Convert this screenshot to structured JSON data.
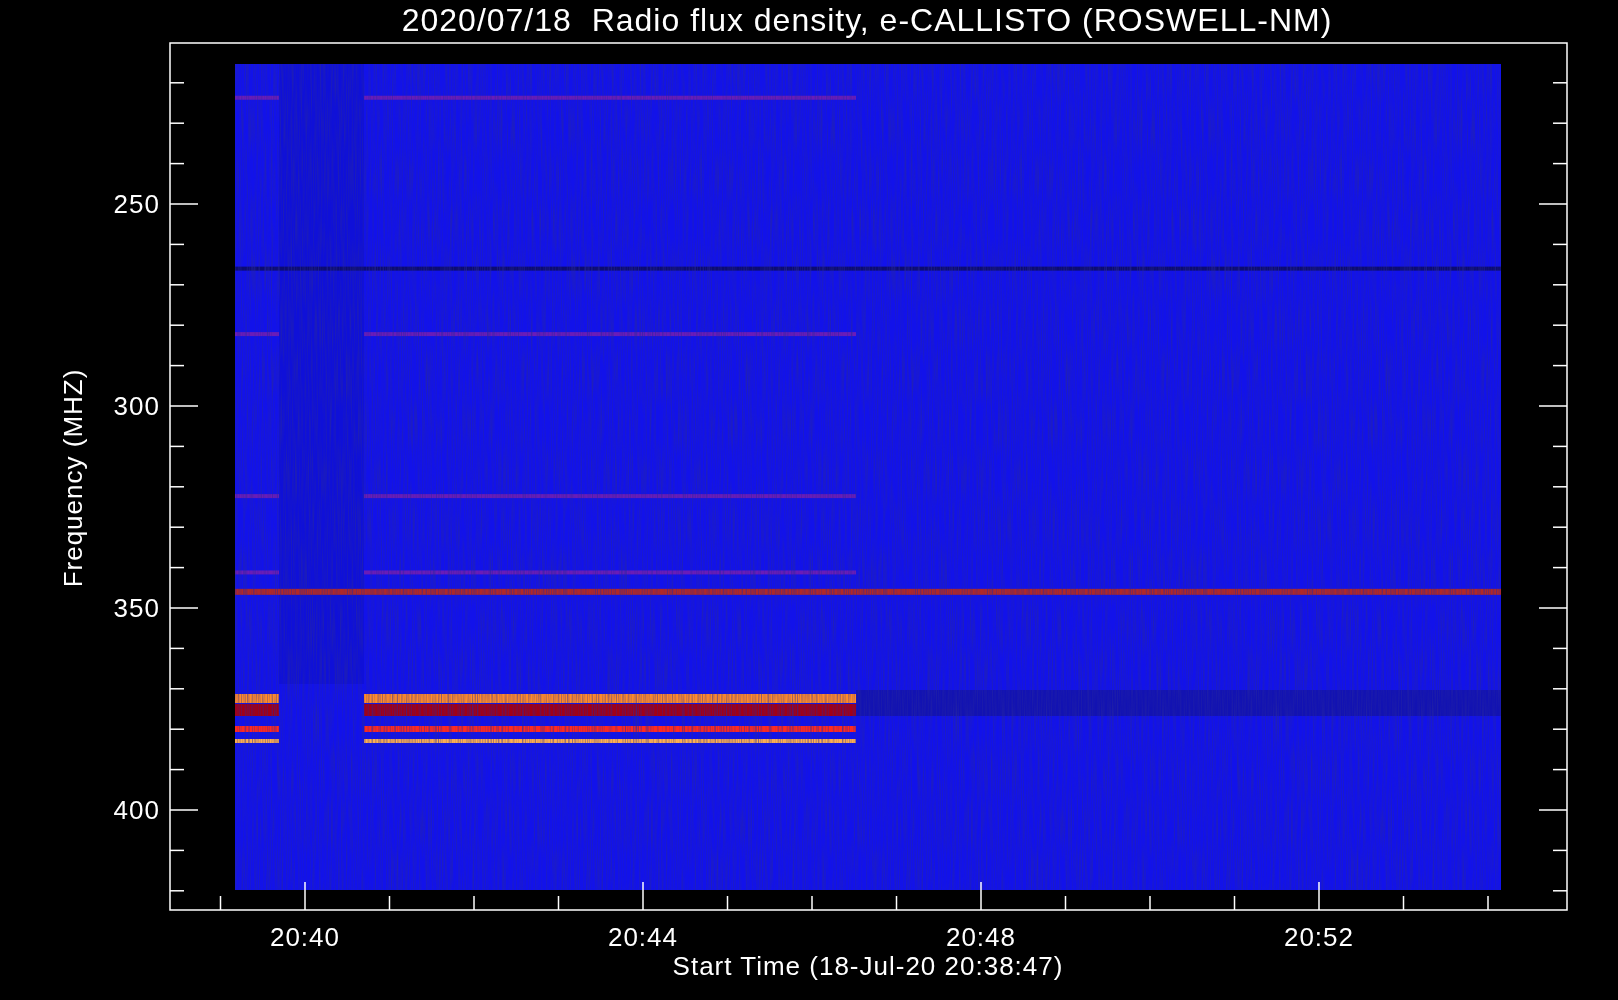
{
  "title": "2020/07/18  Radio flux density, e-CALLISTO (ROSWELL-NM)",
  "xlabel": "Start Time (18-Jul-20 20:38:47)",
  "ylabel": "Frequency (MHZ)",
  "xticks": [
    "20:40",
    "20:44",
    "20:48",
    "20:52"
  ],
  "yticks": [
    "250",
    "300",
    "350",
    "400"
  ]
}
